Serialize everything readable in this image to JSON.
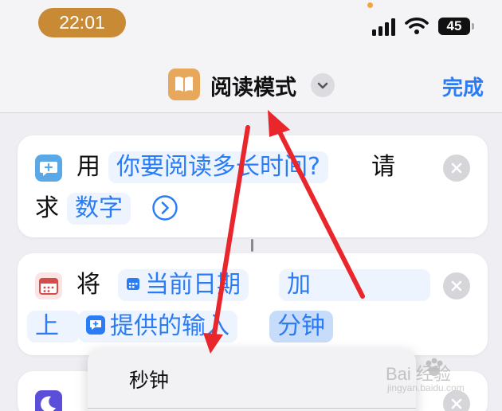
{
  "status_bar": {
    "time": "22:01",
    "battery": "45"
  },
  "nav": {
    "title": "阅读模式",
    "done_label": "完成"
  },
  "card1": {
    "word_use": "用",
    "prompt_token": "你要阅读多长时间?",
    "word_request_1": "请",
    "word_request_2": "求",
    "type_token": "数字"
  },
  "card2": {
    "word_take": "将",
    "date_token": "当前日期",
    "word_add_1": "加",
    "word_add_2": "上",
    "input_token": "提供的输入",
    "unit_token": "分钟"
  },
  "dropdown": {
    "items": [
      {
        "label": "秒钟"
      }
    ]
  },
  "watermark": {
    "text": "Bai 经验",
    "sub": "jingyan.baidu.com"
  },
  "colors": {
    "accent": "#2a7cf6",
    "annotation": "#e8262b",
    "time_pill": "#c98a35",
    "app_icon": "#e7a85c"
  },
  "icons": [
    "signal-icon",
    "wifi-icon",
    "book-icon",
    "chevron-down-icon",
    "message-icon",
    "close-icon",
    "chevron-right-circle-icon",
    "calendar-icon",
    "moon-icon"
  ]
}
